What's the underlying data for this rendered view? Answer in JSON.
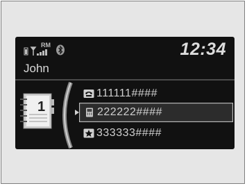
{
  "status": {
    "clock": "12:34",
    "signal_label": "RM",
    "icons": [
      "phone-battery-icon",
      "signal-strength-icon",
      "bluetooth-icon"
    ]
  },
  "contact": {
    "name": "John"
  },
  "phonebook": {
    "index": "1"
  },
  "numbers": [
    {
      "type": "home-phone-icon",
      "number": "111111####",
      "selected": false
    },
    {
      "type": "mobile-phone-icon",
      "number": "222222####",
      "selected": true
    },
    {
      "type": "favorite-star-icon",
      "number": "333333####",
      "selected": false
    }
  ],
  "colors": {
    "screen": "#111111",
    "text": "#d9d9d9",
    "frame": "#e6e6e6"
  }
}
